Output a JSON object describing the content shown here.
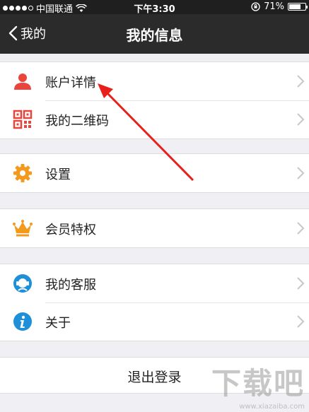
{
  "status_bar": {
    "carrier": "中国联通",
    "time": "下午3:30",
    "battery": "71%",
    "battery_level": 0.71
  },
  "nav": {
    "back_label": "我的",
    "title": "我的信息"
  },
  "groups": [
    {
      "items": [
        {
          "label": "账户详情",
          "icon": "user-icon"
        },
        {
          "label": "我的二维码",
          "icon": "qr-code-icon"
        }
      ]
    },
    {
      "items": [
        {
          "label": "设置",
          "icon": "gear-icon"
        }
      ]
    },
    {
      "items": [
        {
          "label": "会员特权",
          "icon": "crown-icon"
        }
      ]
    },
    {
      "items": [
        {
          "label": "我的客服",
          "icon": "customer-service-icon"
        },
        {
          "label": "关于",
          "icon": "info-icon"
        }
      ]
    }
  ],
  "logout_label": "退出登录",
  "watermark": {
    "text": "下载吧",
    "url": "www.xiazaiba.com"
  },
  "colors": {
    "navbar": "#2b2b2b",
    "background": "#efeff4",
    "annotation": "#e8201c",
    "accent_orange": "#f39a1e",
    "accent_blue": "#1e8fd9"
  }
}
